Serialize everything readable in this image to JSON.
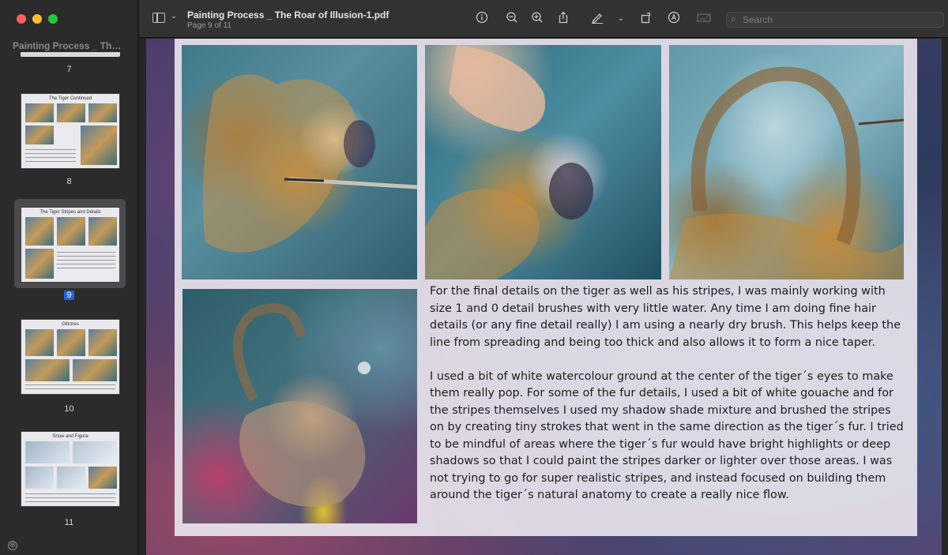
{
  "window": {
    "doc_title": "Painting Process _ The Roar of Illusion-1.pdf",
    "page_indicator": "Page 9 of 11"
  },
  "sidebar": {
    "title": "Painting Process _ The R...",
    "thumbnails": [
      {
        "number": "7",
        "title": ""
      },
      {
        "number": "8",
        "title": "The Tiger Continued"
      },
      {
        "number": "9",
        "title": "The Tiger Stripes and Details",
        "selected": true
      },
      {
        "number": "10",
        "title": "Glitches"
      },
      {
        "number": "11",
        "title": "Snow and Figure"
      }
    ],
    "add_icon": "⊕"
  },
  "toolbar": {
    "icons": [
      "info-icon",
      "zoom-out-icon",
      "zoom-in-icon",
      "share-icon",
      "markup-pen-icon",
      "chevron-down-icon",
      "rotate-icon",
      "markup-circle-icon",
      "form-fill-icon"
    ],
    "search_placeholder": "Search"
  },
  "page": {
    "paragraph1": "For the final details on the tiger as well as his stripes, I was mainly working with size 1 and 0 detail brushes with very little water.  Any time I am doing fine hair details (or any fine detail really) I am using a nearly dry brush.  This helps keep the line from spreading and being too thick and also allows it to form a nice taper.",
    "paragraph2": "I used a bit of white watercolour ground at the center of the tiger´s eyes to make them really pop.  For some of the fur details, I used a bit of white gouache and for the stripes themselves I used my shadow shade mixture and brushed the stripes on by creating tiny strokes that went in the same direction as the tiger´s fur.  I tried to be mindful of areas where the tiger´s fur would have bright highlights or deep shadows so that I could paint the stripes darker or lighter over those areas.  I was not trying to go for super realistic stripes, and instead focused on building them around the tiger´s natural anatomy to create a really nice flow."
  },
  "colors": {
    "accent": "#2662d9",
    "sidebar_bg": "#2b2b2b",
    "toolbar_bg": "#323232"
  }
}
